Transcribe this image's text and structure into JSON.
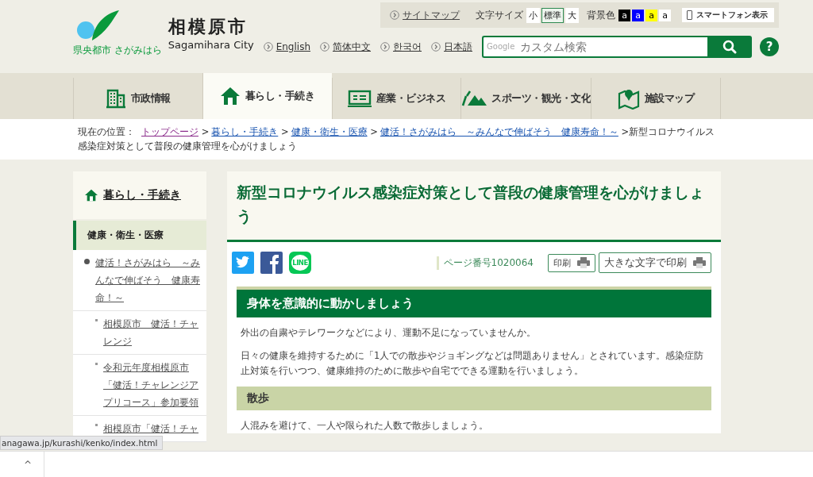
{
  "logo": {
    "tagline": "県央都市 さがみはら",
    "name": "相模原市",
    "name_en": "Sagamihara City"
  },
  "utility_bar": {
    "sitemap": "サイトマップ",
    "font_size_label": "文字サイズ",
    "font_sizes": [
      {
        "label": "小",
        "selected": false
      },
      {
        "label": "標準",
        "selected": true
      },
      {
        "label": "大",
        "selected": false
      }
    ],
    "bg_color_label": "背景色",
    "bg_colors": [
      {
        "label": "a",
        "color": "#000000"
      },
      {
        "label": "a",
        "color": "#0000ff"
      },
      {
        "label": "a",
        "color": "#ffff00"
      },
      {
        "label": "a",
        "color": "#ffffff"
      }
    ],
    "smartphone": "スマートフォン表示"
  },
  "languages": [
    "English",
    "简体中文",
    "한국어",
    "日本語"
  ],
  "search": {
    "placeholder": "カスタム検索",
    "brand": "Google",
    "help": "?"
  },
  "tabs": [
    {
      "label": "市政情報",
      "selected": false
    },
    {
      "label": "暮らし・手続き",
      "selected": true
    },
    {
      "label": "産業・ビジネス",
      "selected": false
    },
    {
      "label": "スポーツ・観光・文化",
      "selected": false
    },
    {
      "label": "施設マップ",
      "selected": false
    }
  ],
  "breadcrumb": {
    "label": "現在の位置：",
    "links": [
      {
        "text": "トップページ",
        "visited": true,
        "separator": ">"
      },
      {
        "text": "暮らし・手続き",
        "visited": false,
        "separator": ">"
      },
      {
        "text": "健康・衛生・医療",
        "visited": false,
        "separator": ">"
      },
      {
        "text": "健活！さがみはら　～みんなで伸ばそう　健康寿命！～",
        "visited": false,
        "separator": ">"
      }
    ],
    "current": "新型コロナウイルス感染症対策として普段の健康管理を心がけましょう"
  },
  "sidebar": {
    "title": "暮らし・手続き",
    "section": "健康・衛生・医療",
    "items": [
      {
        "label": "健活！さがみはら　～みんなで伸ばそう　健康寿命！～",
        "children": [
          {
            "label": "相模原市　健活！チャレンジ"
          },
          {
            "label": "令和元年度相模原市「健活！チャレンジアプリコース」参加要領"
          },
          {
            "label": "相模原市「健活！チャ"
          }
        ]
      }
    ]
  },
  "article": {
    "title": "新型コロナウイルス感染症対策として普段の健康管理を心がけましょう",
    "line_label": "LINE",
    "page_number": "ページ番号1020064",
    "print": "印刷",
    "print_large": "大きな文字で印刷",
    "blocks": [
      {
        "kind": "h2",
        "text": "身体を意識的に動かしましょう"
      },
      {
        "kind": "p",
        "text": "外出の自粛やテレワークなどにより、運動不足になっていませんか。"
      },
      {
        "kind": "p",
        "text": "日々の健康を維持するために「1人での散歩やジョギングなどは問題ありません」とされています。感染症防止対策を行いつつ、健康維持のために散歩や自宅でできる運動を行いましょう。"
      },
      {
        "kind": "h3",
        "text": "散歩"
      },
      {
        "kind": "p",
        "text": "人混みを避けて、一人や限られた人数で散歩しましょう。"
      }
    ]
  },
  "status_url": "anagawa.jp/kurashi/kenko/index.html",
  "download_bar": {
    "caret": "^"
  }
}
